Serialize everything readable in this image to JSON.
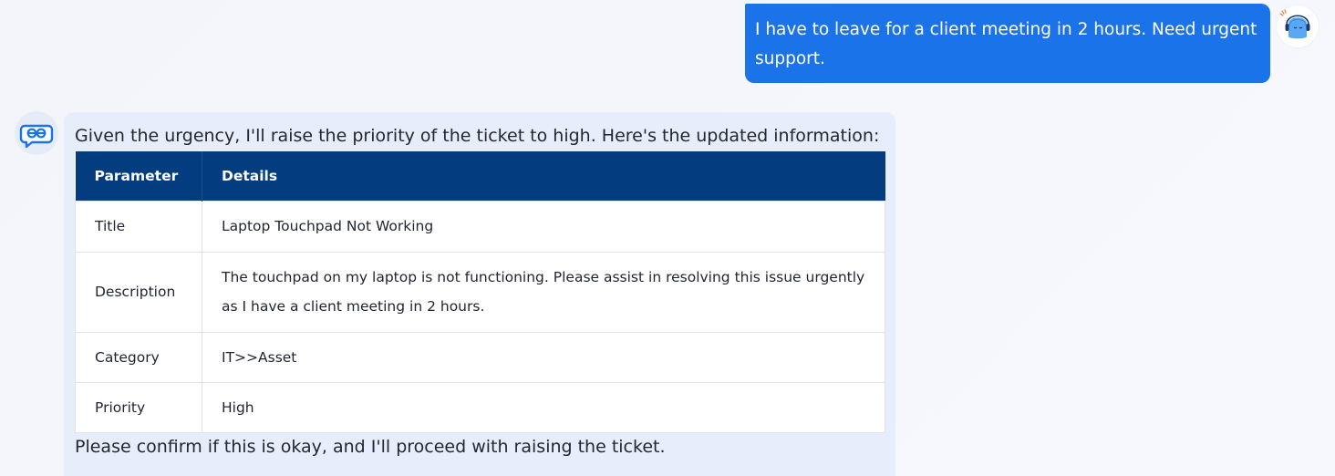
{
  "user_message": {
    "text": "I have to leave for a client meeting in 2 hours. Need urgent support.",
    "bubble_color": "#1a73e8",
    "avatar_icon": "user-mascot-icon"
  },
  "bot_message": {
    "intro": "Given the urgency, I'll raise the priority of the ticket to high. Here's the updated information:",
    "outro": "Please confirm if this is okay, and I'll proceed with raising the ticket.",
    "avatar_icon": "bot-chat-icon",
    "bubble_color": "#e7eefb"
  },
  "table": {
    "header_color": "#033d80",
    "headers": [
      "Parameter",
      "Details"
    ],
    "rows": [
      [
        "Title",
        "Laptop Touchpad Not Working"
      ],
      [
        "Description",
        "The touchpad on my laptop is not functioning. Please assist in resolving this issue urgently as I have a client meeting in 2 hours."
      ],
      [
        "Category",
        "IT>>Asset"
      ],
      [
        "Priority",
        "High"
      ]
    ]
  }
}
